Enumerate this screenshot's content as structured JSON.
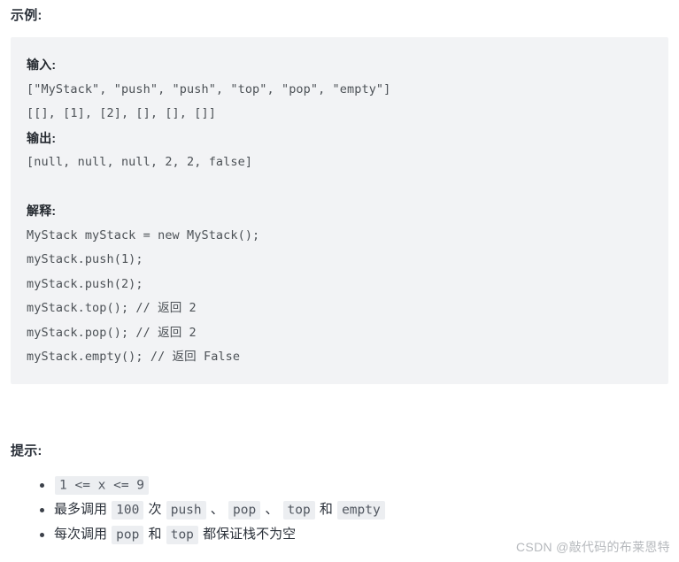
{
  "example": {
    "heading": "示例:",
    "blocks": [
      {
        "type": "label",
        "text": "输入:"
      },
      {
        "type": "code",
        "text": "[\"MyStack\", \"push\", \"push\", \"top\", \"pop\", \"empty\"]"
      },
      {
        "type": "code",
        "text": "[[], [1], [2], [], [], []]"
      },
      {
        "type": "label",
        "text": "输出:"
      },
      {
        "type": "code",
        "text": "[null, null, null, 2, 2, false]"
      },
      {
        "type": "blank",
        "text": ""
      },
      {
        "type": "label",
        "text": "解释:"
      },
      {
        "type": "code",
        "text": "MyStack myStack = new MyStack();"
      },
      {
        "type": "code",
        "text": "myStack.push(1);"
      },
      {
        "type": "code",
        "text": "myStack.push(2);"
      },
      {
        "type": "code",
        "text": "myStack.top(); // 返回 2"
      },
      {
        "type": "code",
        "text": "myStack.pop(); // 返回 2"
      },
      {
        "type": "code",
        "text": "myStack.empty(); // 返回 False"
      }
    ]
  },
  "hints": {
    "heading": "提示:",
    "items": [
      {
        "parts": [
          {
            "kind": "code",
            "text": "1 <= x <= 9"
          }
        ]
      },
      {
        "parts": [
          {
            "kind": "text",
            "text": "最多调用 "
          },
          {
            "kind": "code",
            "text": "100"
          },
          {
            "kind": "text",
            "text": " 次 "
          },
          {
            "kind": "code",
            "text": "push"
          },
          {
            "kind": "text",
            "text": " 、 "
          },
          {
            "kind": "code",
            "text": "pop"
          },
          {
            "kind": "text",
            "text": " 、 "
          },
          {
            "kind": "code",
            "text": "top"
          },
          {
            "kind": "text",
            "text": " 和 "
          },
          {
            "kind": "code",
            "text": "empty"
          }
        ]
      },
      {
        "parts": [
          {
            "kind": "text",
            "text": "每次调用 "
          },
          {
            "kind": "code",
            "text": "pop"
          },
          {
            "kind": "text",
            "text": " 和 "
          },
          {
            "kind": "code",
            "text": "top"
          },
          {
            "kind": "text",
            "text": " 都保证栈不为空"
          }
        ]
      }
    ]
  },
  "watermark": {
    "text": "CSDN @敲代码的布莱恩特"
  },
  "colors": {
    "code_block_bg": "#f2f3f5",
    "inline_code_bg": "#eceef1",
    "heading_text": "#2b313a",
    "code_text": "#4c5156",
    "watermark_text": "#b6b9bd"
  }
}
